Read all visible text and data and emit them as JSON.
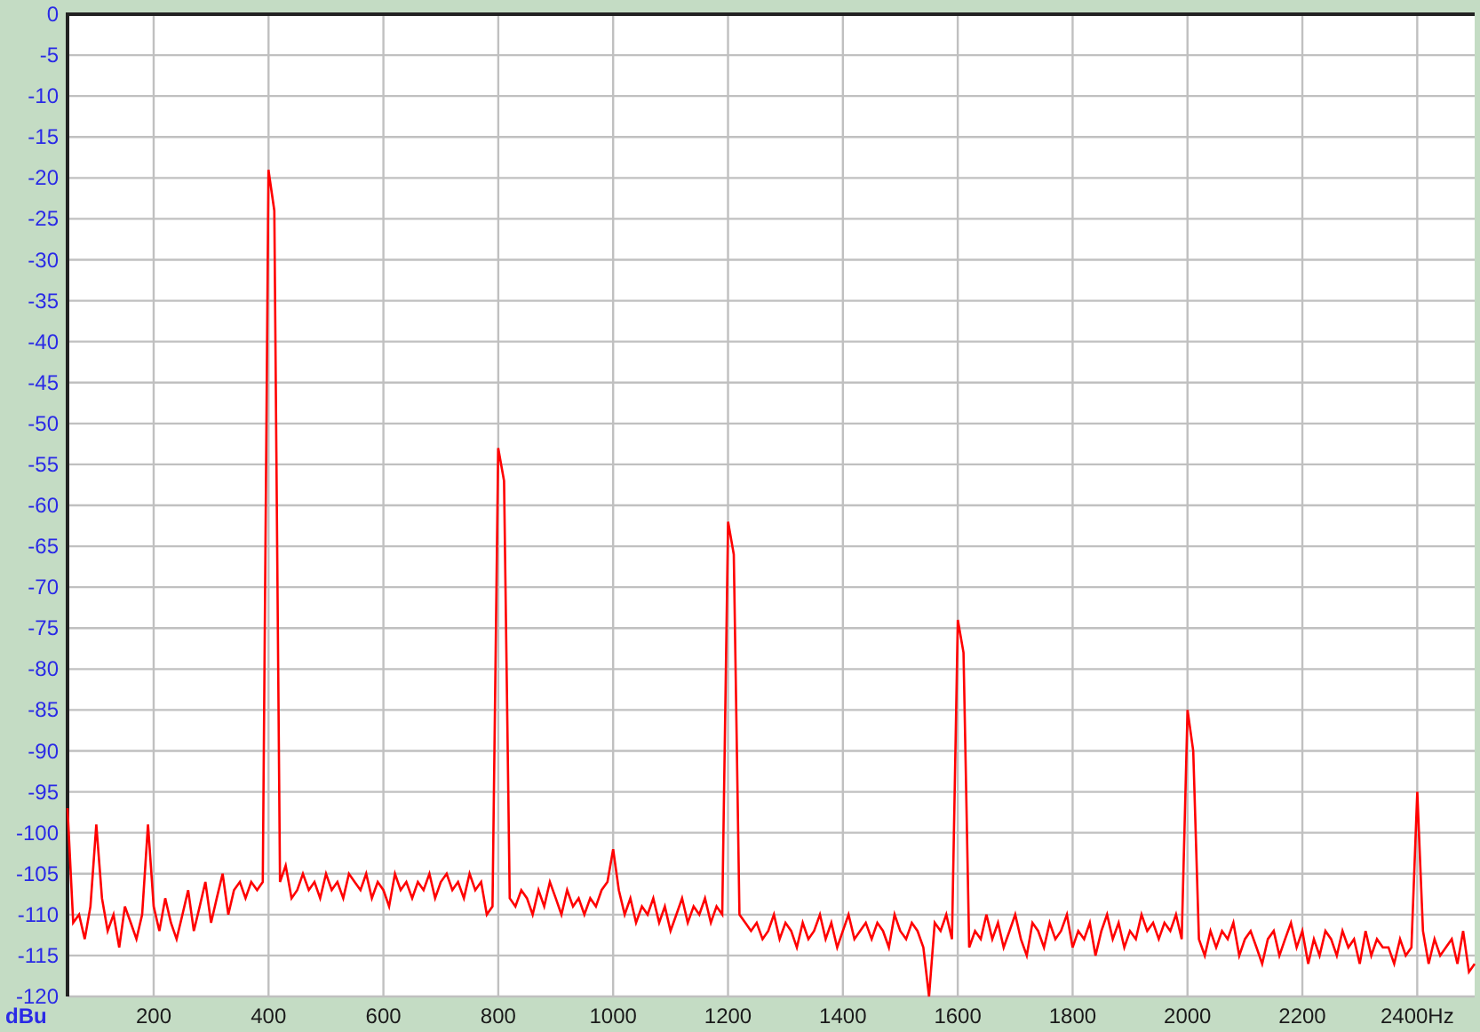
{
  "chart": {
    "chart_data": {
      "type": "line",
      "grid": true,
      "ylabel": "dBu",
      "xlim": [
        50,
        2500
      ],
      "ylim": [
        -120,
        0
      ],
      "xticks": [
        200,
        400,
        600,
        800,
        1000,
        1200,
        1400,
        1600,
        1800,
        2000,
        2200,
        {
          "value": 2400,
          "label": "2400Hz"
        }
      ],
      "yticks": [
        0,
        -5,
        -10,
        -15,
        -20,
        -25,
        -30,
        -35,
        -40,
        -45,
        -50,
        -55,
        -60,
        -65,
        -70,
        -75,
        -80,
        -85,
        -90,
        -95,
        -100,
        -105,
        -110,
        -115,
        -120
      ],
      "x": [
        50,
        60,
        70,
        80,
        90,
        100,
        110,
        120,
        130,
        140,
        150,
        160,
        170,
        180,
        190,
        200,
        210,
        220,
        230,
        240,
        250,
        260,
        270,
        280,
        290,
        300,
        310,
        320,
        330,
        340,
        350,
        360,
        370,
        380,
        390,
        400,
        410,
        420,
        430,
        440,
        450,
        460,
        470,
        480,
        490,
        500,
        510,
        520,
        530,
        540,
        550,
        560,
        570,
        580,
        590,
        600,
        610,
        620,
        630,
        640,
        650,
        660,
        670,
        680,
        690,
        700,
        710,
        720,
        730,
        740,
        750,
        760,
        770,
        780,
        790,
        800,
        810,
        820,
        830,
        840,
        850,
        860,
        870,
        880,
        890,
        900,
        910,
        920,
        930,
        940,
        950,
        960,
        970,
        980,
        990,
        1000,
        1010,
        1020,
        1030,
        1040,
        1050,
        1060,
        1070,
        1080,
        1090,
        1100,
        1110,
        1120,
        1130,
        1140,
        1150,
        1160,
        1170,
        1180,
        1190,
        1200,
        1210,
        1220,
        1230,
        1240,
        1250,
        1260,
        1270,
        1280,
        1290,
        1300,
        1310,
        1320,
        1330,
        1340,
        1350,
        1360,
        1370,
        1380,
        1390,
        1400,
        1410,
        1420,
        1430,
        1440,
        1450,
        1460,
        1470,
        1480,
        1490,
        1500,
        1510,
        1520,
        1530,
        1540,
        1550,
        1560,
        1570,
        1580,
        1590,
        1600,
        1610,
        1620,
        1630,
        1640,
        1650,
        1660,
        1670,
        1680,
        1690,
        1700,
        1710,
        1720,
        1730,
        1740,
        1750,
        1760,
        1770,
        1780,
        1790,
        1800,
        1810,
        1820,
        1830,
        1840,
        1850,
        1860,
        1870,
        1880,
        1890,
        1900,
        1910,
        1920,
        1930,
        1940,
        1950,
        1960,
        1970,
        1980,
        1990,
        2000,
        2010,
        2020,
        2030,
        2040,
        2050,
        2060,
        2070,
        2080,
        2090,
        2100,
        2110,
        2120,
        2130,
        2140,
        2150,
        2160,
        2170,
        2180,
        2190,
        2200,
        2210,
        2220,
        2230,
        2240,
        2250,
        2260,
        2270,
        2280,
        2290,
        2300,
        2310,
        2320,
        2330,
        2340,
        2350,
        2360,
        2370,
        2380,
        2390,
        2400,
        2410,
        2420,
        2430,
        2440,
        2450,
        2460,
        2470,
        2480,
        2490,
        2500
      ],
      "series": [
        {
          "color": "#ff0000",
          "values": [
            -97,
            -111,
            -110,
            -113,
            -109,
            -99,
            -108,
            -112,
            -110,
            -114,
            -109,
            -111,
            -113,
            -110,
            -99,
            -109,
            -112,
            -108,
            -111,
            -113,
            -110,
            -107,
            -112,
            -109,
            -106,
            -111,
            -108,
            -105,
            -110,
            -107,
            -106,
            -108,
            -106,
            -107,
            -106,
            -19,
            -24,
            -106,
            -104,
            -108,
            -107,
            -105,
            -107,
            -106,
            -108,
            -105,
            -107,
            -106,
            -108,
            -105,
            -106,
            -107,
            -105,
            -108,
            -106,
            -107,
            -109,
            -105,
            -107,
            -106,
            -108,
            -106,
            -107,
            -105,
            -108,
            -106,
            -105,
            -107,
            -106,
            -108,
            -105,
            -107,
            -106,
            -110,
            -109,
            -53,
            -57,
            -108,
            -109,
            -107,
            -108,
            -110,
            -107,
            -109,
            -106,
            -108,
            -110,
            -107,
            -109,
            -108,
            -110,
            -108,
            -109,
            -107,
            -106,
            -102,
            -107,
            -110,
            -108,
            -111,
            -109,
            -110,
            -108,
            -111,
            -109,
            -112,
            -110,
            -108,
            -111,
            -109,
            -110,
            -108,
            -111,
            -109,
            -110,
            -62,
            -66,
            -110,
            -111,
            -112,
            -111,
            -113,
            -112,
            -110,
            -113,
            -111,
            -112,
            -114,
            -111,
            -113,
            -112,
            -110,
            -113,
            -111,
            -114,
            -112,
            -110,
            -113,
            -112,
            -111,
            -113,
            -111,
            -112,
            -114,
            -110,
            -112,
            -113,
            -111,
            -112,
            -114,
            -120,
            -111,
            -112,
            -110,
            -113,
            -74,
            -78,
            -114,
            -112,
            -113,
            -110,
            -113,
            -111,
            -114,
            -112,
            -110,
            -113,
            -115,
            -111,
            -112,
            -114,
            -111,
            -113,
            -112,
            -110,
            -114,
            -112,
            -113,
            -111,
            -115,
            -112,
            -110,
            -113,
            -111,
            -114,
            -112,
            -113,
            -110,
            -112,
            -111,
            -113,
            -111,
            -112,
            -110,
            -113,
            -85,
            -90,
            -113,
            -115,
            -112,
            -114,
            -112,
            -113,
            -111,
            -115,
            -113,
            -112,
            -114,
            -116,
            -113,
            -112,
            -115,
            -113,
            -111,
            -114,
            -112,
            -116,
            -113,
            -115,
            -112,
            -113,
            -115,
            -112,
            -114,
            -113,
            -116,
            -112,
            -115,
            -113,
            -114,
            -114,
            -116,
            -113,
            -115,
            -114,
            -95,
            -112,
            -116,
            -113,
            -115,
            -114,
            -113,
            -116,
            -112,
            -117,
            -116
          ]
        }
      ]
    }
  }
}
